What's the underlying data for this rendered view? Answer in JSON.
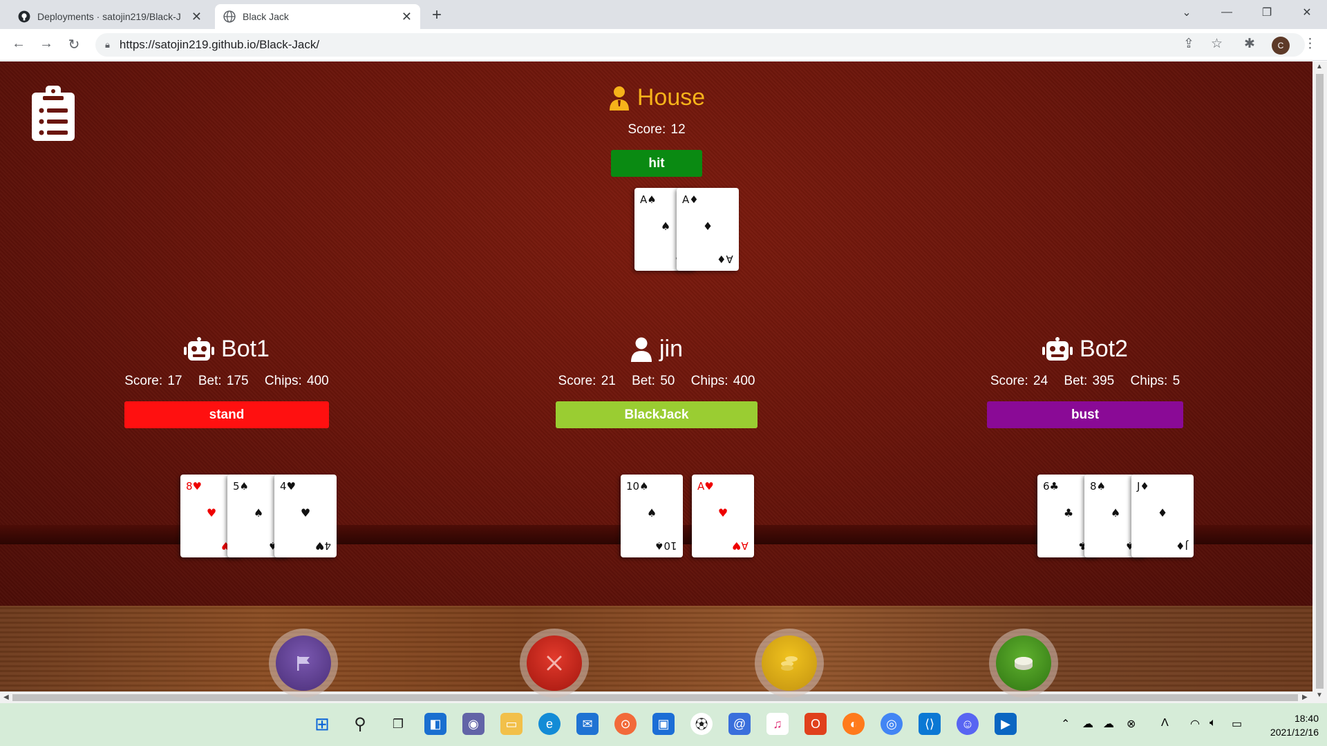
{
  "browser": {
    "tabs": [
      {
        "title": "Deployments · satojin219/Black-J",
        "active": false
      },
      {
        "title": "Black Jack",
        "active": true
      }
    ],
    "url": "https://satojin219.github.io/Black-Jack/",
    "profile_initial": "C"
  },
  "house": {
    "name": "House",
    "score_text": "Score: 12",
    "status": "hit",
    "status_color": "#0a8a12",
    "cards": [
      {
        "rank": "A",
        "suit": "♠",
        "color": "black"
      },
      {
        "rank": "A",
        "suit": "♦",
        "color": "black"
      }
    ]
  },
  "players": [
    {
      "name": "Bot1",
      "icon": "robot-icon",
      "score_text": "Score: 17",
      "bet_text": "Bet: 175",
      "chips_text": "Chips: 400",
      "status": "stand",
      "status_color": "#ff1010",
      "cards": [
        {
          "rank": "8",
          "suit": "♥",
          "color": "red"
        },
        {
          "rank": "5",
          "suit": "♠",
          "color": "black"
        },
        {
          "rank": "4",
          "suit": "♥",
          "color": "black"
        }
      ]
    },
    {
      "name": "jin",
      "icon": "user-icon",
      "score_text": "Score: 21",
      "bet_text": "Bet: 50",
      "chips_text": "Chips: 400",
      "status": "BlackJack",
      "status_color": "#9acd32",
      "cards": [
        {
          "rank": "10",
          "suit": "♠",
          "color": "black"
        },
        {
          "rank": "A",
          "suit": "♥",
          "color": "red"
        }
      ]
    },
    {
      "name": "Bot2",
      "icon": "robot-icon",
      "score_text": "Score: 24",
      "bet_text": "Bet: 395",
      "chips_text": "Chips: 5",
      "status": "bust",
      "status_color": "#8a0a96",
      "cards": [
        {
          "rank": "6",
          "suit": "♣",
          "color": "black"
        },
        {
          "rank": "8",
          "suit": "♠",
          "color": "black"
        },
        {
          "rank": "J",
          "suit": "♦",
          "color": "black"
        }
      ]
    }
  ],
  "actions": [
    {
      "name": "surrender",
      "icon": "flag-icon",
      "color": "#5b3d8c"
    },
    {
      "name": "hit",
      "icon": "swords-icon",
      "color": "#c8221a"
    },
    {
      "name": "double",
      "icon": "coins-icon",
      "color": "#d8a812"
    },
    {
      "name": "stand",
      "icon": "chip-icon",
      "color": "#3c8a1c"
    }
  ],
  "taskbar": {
    "time": "18:40",
    "date": "2021/12/16"
  }
}
